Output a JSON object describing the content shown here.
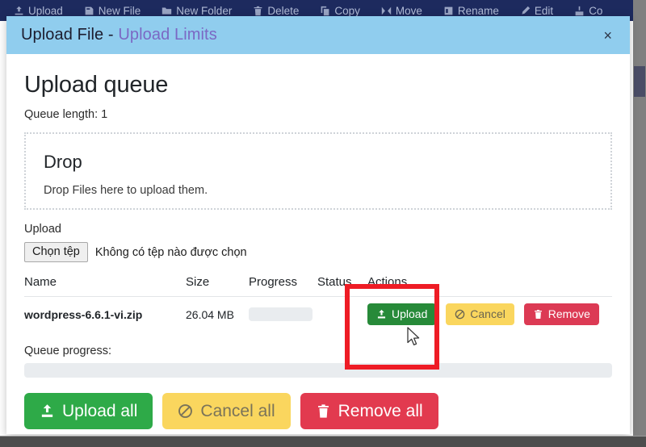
{
  "background_app": {
    "toolbar_items": [
      {
        "label": "Upload",
        "icon": "upload-icon"
      },
      {
        "label": "New File",
        "icon": "new-file-icon"
      },
      {
        "label": "New Folder",
        "icon": "new-folder-icon"
      },
      {
        "label": "Delete",
        "icon": "trash-icon"
      },
      {
        "label": "Copy",
        "icon": "copy-icon"
      },
      {
        "label": "Move",
        "icon": "move-icon"
      },
      {
        "label": "Rename",
        "icon": "rename-icon"
      },
      {
        "label": "Edit",
        "icon": "edit-icon"
      },
      {
        "label": "Co",
        "icon": "compress-icon"
      }
    ]
  },
  "modal": {
    "title_main": "Upload File - ",
    "title_accent": "Upload Limits",
    "close_label": "×",
    "heading": "Upload queue",
    "queue_length": "Queue length: 1",
    "dropzone": {
      "title": "Drop",
      "text": "Drop Files here to upload them."
    },
    "upload_label": "Upload",
    "file_input": {
      "button_label": "Chọn tệp",
      "chosen_text": "Không có tệp nào được chọn"
    },
    "table": {
      "columns": [
        "Name",
        "Size",
        "Progress",
        "Status",
        "Actions"
      ],
      "rows": [
        {
          "name": "wordpress-6.6.1-vi.zip",
          "size": "26.04 MB",
          "progress": 0,
          "status": "",
          "actions": [
            {
              "label": "Upload",
              "icon": "upload-icon",
              "style": "green"
            },
            {
              "label": "Cancel",
              "icon": "ban-icon",
              "style": "yellow"
            },
            {
              "label": "Remove",
              "icon": "trash-icon",
              "style": "red"
            }
          ]
        }
      ]
    },
    "queue_progress_label": "Queue progress:",
    "queue_progress_value": 0,
    "footer_buttons": [
      {
        "label": "Upload all",
        "icon": "upload-icon",
        "style": "green"
      },
      {
        "label": "Cancel all",
        "icon": "ban-icon",
        "style": "yellow"
      },
      {
        "label": "Remove all",
        "icon": "trash-icon",
        "style": "red"
      }
    ]
  },
  "annotation": {
    "color": "#ee1c25",
    "target": "row-upload-button"
  },
  "colors": {
    "header_blue": "#90cdee",
    "title_accent": "#7b68c4",
    "green": "#2eaa48",
    "yellow": "#fad65e",
    "red": "#e23a4f",
    "toolbar_navy": "#1d2a5e",
    "backdrop_gray": "#808080"
  }
}
